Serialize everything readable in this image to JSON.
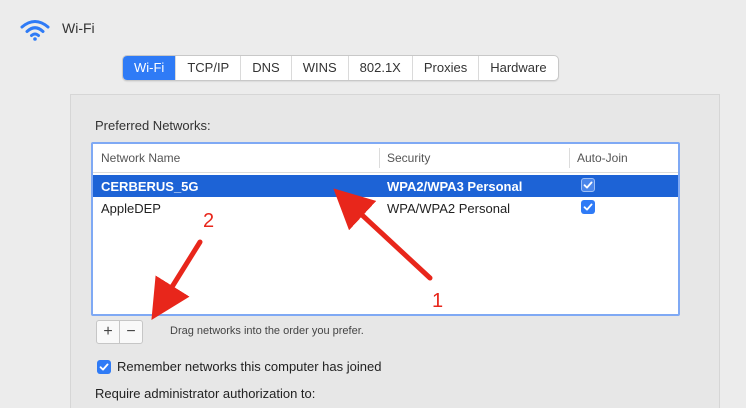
{
  "header": {
    "title": "Wi-Fi",
    "icon": "wifi-icon"
  },
  "tabs": [
    {
      "label": "Wi-Fi",
      "active": true
    },
    {
      "label": "TCP/IP",
      "active": false
    },
    {
      "label": "DNS",
      "active": false
    },
    {
      "label": "WINS",
      "active": false
    },
    {
      "label": "802.1X",
      "active": false
    },
    {
      "label": "Proxies",
      "active": false
    },
    {
      "label": "Hardware",
      "active": false
    }
  ],
  "preferred": {
    "label": "Preferred Networks:",
    "columns": {
      "name": "Network Name",
      "security": "Security",
      "autojoin": "Auto-Join"
    },
    "rows": [
      {
        "name": "CERBERUS_5G",
        "security": "WPA2/WPA3 Personal",
        "autojoin": true,
        "selected": true
      },
      {
        "name": "AppleDEP",
        "security": "WPA/WPA2 Personal",
        "autojoin": true,
        "selected": false
      }
    ]
  },
  "controls": {
    "add": "+",
    "remove": "−",
    "hint": "Drag networks into the order you prefer."
  },
  "options": {
    "remember": "Remember networks this computer has joined",
    "require": "Require administrator authorization to:"
  },
  "annotations": {
    "label1": "1",
    "label2": "2",
    "color": "#e8261b"
  },
  "colors": {
    "accent": "#2f7bf6",
    "selection": "#1d63d6"
  }
}
